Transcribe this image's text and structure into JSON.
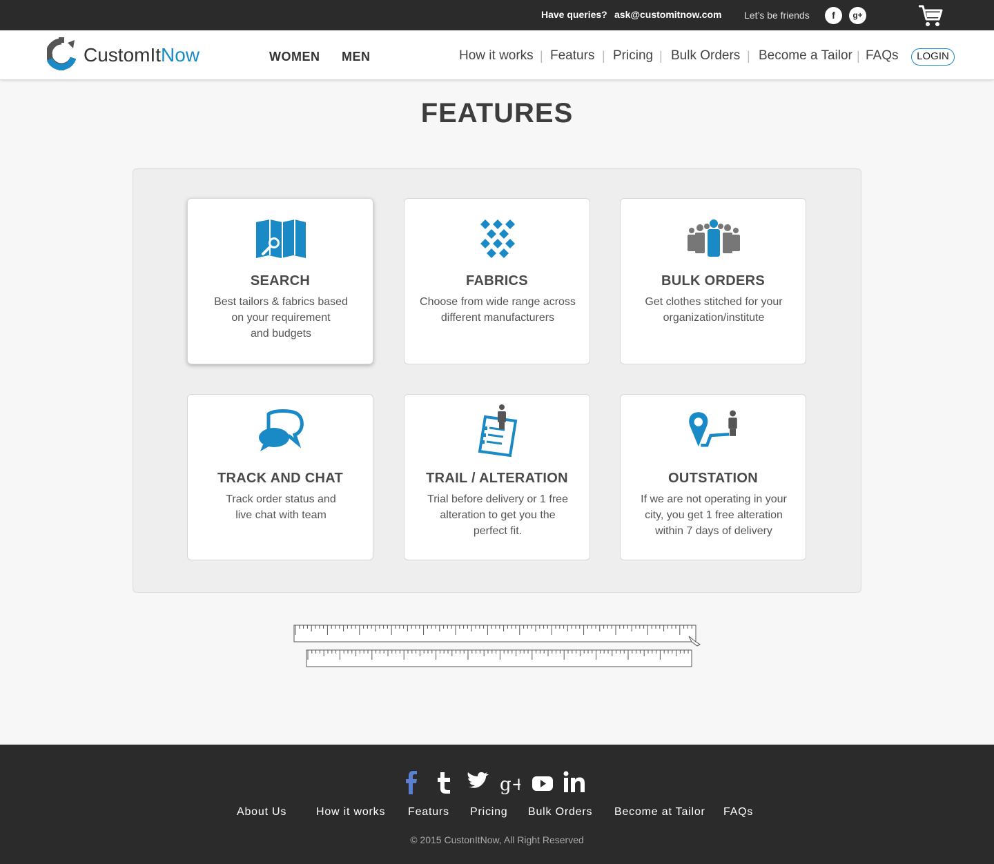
{
  "topbar": {
    "queries_label": "Have queries?",
    "email": "ask@customitnow.com",
    "friends_label": "Let’s be friends",
    "social": [
      "f",
      "g+"
    ]
  },
  "header": {
    "brand_prefix": "CustomIt",
    "brand_suffix": "Now",
    "main_nav": [
      "WOMEN",
      "MEN"
    ],
    "sub_nav": [
      "How it works",
      "Featurs",
      "Pricing",
      "Bulk Orders",
      "Become a Tailor",
      "FAQs"
    ],
    "login_label": "LOGIN"
  },
  "page": {
    "title": "FEATURES"
  },
  "features": [
    {
      "icon": "map-search-icon",
      "title": "SEARCH",
      "lines": [
        "Best tailors & fabrics based",
        "on your requirement",
        "and budgets"
      ]
    },
    {
      "icon": "fabric-pattern-icon",
      "title": "FABRICS",
      "lines": [
        "Choose from wide range across",
        "different manufacturers"
      ]
    },
    {
      "icon": "group-people-icon",
      "title": "BULK ORDERS",
      "lines": [
        "Get clothes stitched for your",
        "organization/institute"
      ]
    },
    {
      "icon": "chat-bubbles-icon",
      "title": "TRACK AND CHAT",
      "lines": [
        "Track order status and",
        "live chat with team"
      ]
    },
    {
      "icon": "clipboard-person-icon",
      "title": "TRAIL / ALTERATION",
      "lines": [
        "Trial before delivery or 1 free",
        "alteration to get you the",
        "perfect fit."
      ]
    },
    {
      "icon": "location-person-icon",
      "title": "OUTSTATION",
      "lines": [
        "If we are not operating in your",
        "city, you get 1 free alteration",
        "within 7 days of delivery"
      ]
    }
  ],
  "footer": {
    "social_icons": [
      "facebook-icon",
      "tumblr-icon",
      "twitter-icon",
      "google-plus-icon",
      "youtube-icon",
      "linkedin-icon"
    ],
    "links": [
      "About Us",
      "How it works",
      "Featurs",
      "Pricing",
      "Bulk Orders",
      "Become at Tailor",
      "FAQs"
    ],
    "copyright": "© 2015 CustonItNow, All Right Reserved"
  },
  "colors": {
    "accent": "#1a8ac6",
    "dark": "#2b2b2b",
    "icon_gray": "#777777"
  }
}
